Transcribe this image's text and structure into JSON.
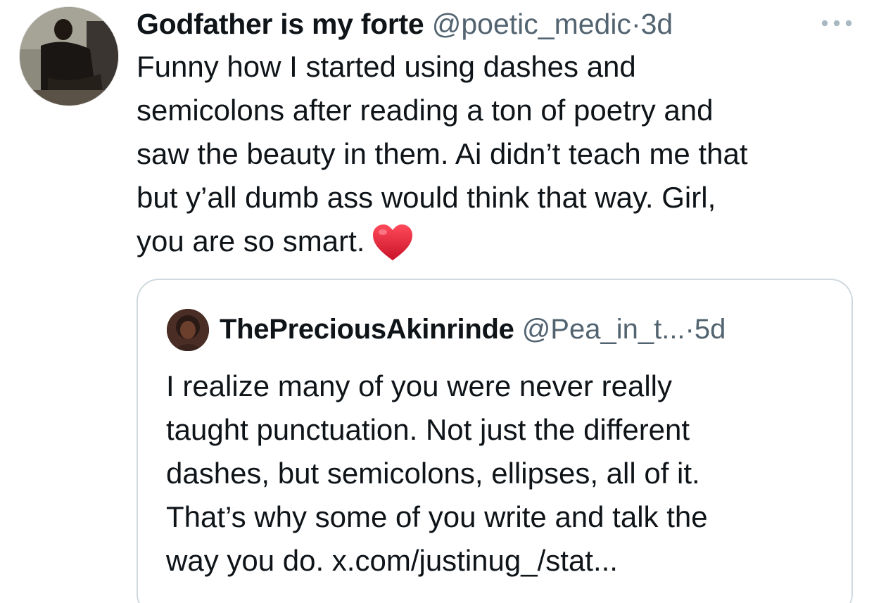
{
  "tweet": {
    "display_name": "Godfather is my forte",
    "handle": "@poetic_medic",
    "separator": "·",
    "time": "3d",
    "text": "Funny how I started using dashes and\nsemicolons after reading a ton of poetry and\nsaw the beauty in them. Ai didn’t teach me that\nbut y’all dumb ass would think that way. Girl,\nyou are so smart.",
    "emoji_icon": "red-heart-icon",
    "more_icon": "more-horizontal-icon"
  },
  "quoted_tweet": {
    "display_name": "ThePreciousAkinrinde",
    "handle": "@Pea_in_t...",
    "separator": "·",
    "time": "5d",
    "text": "I realize many of you were never really\ntaught punctuation. Not just the different\ndashes, but semicolons, ellipses, all of it.\nThat’s why some of you write and talk the\nway you do. x.com/justinug_/stat..."
  },
  "colors": {
    "text_primary": "#0f1419",
    "text_secondary": "#536471",
    "border": "#cfd9de",
    "heart": "#e0243a"
  }
}
